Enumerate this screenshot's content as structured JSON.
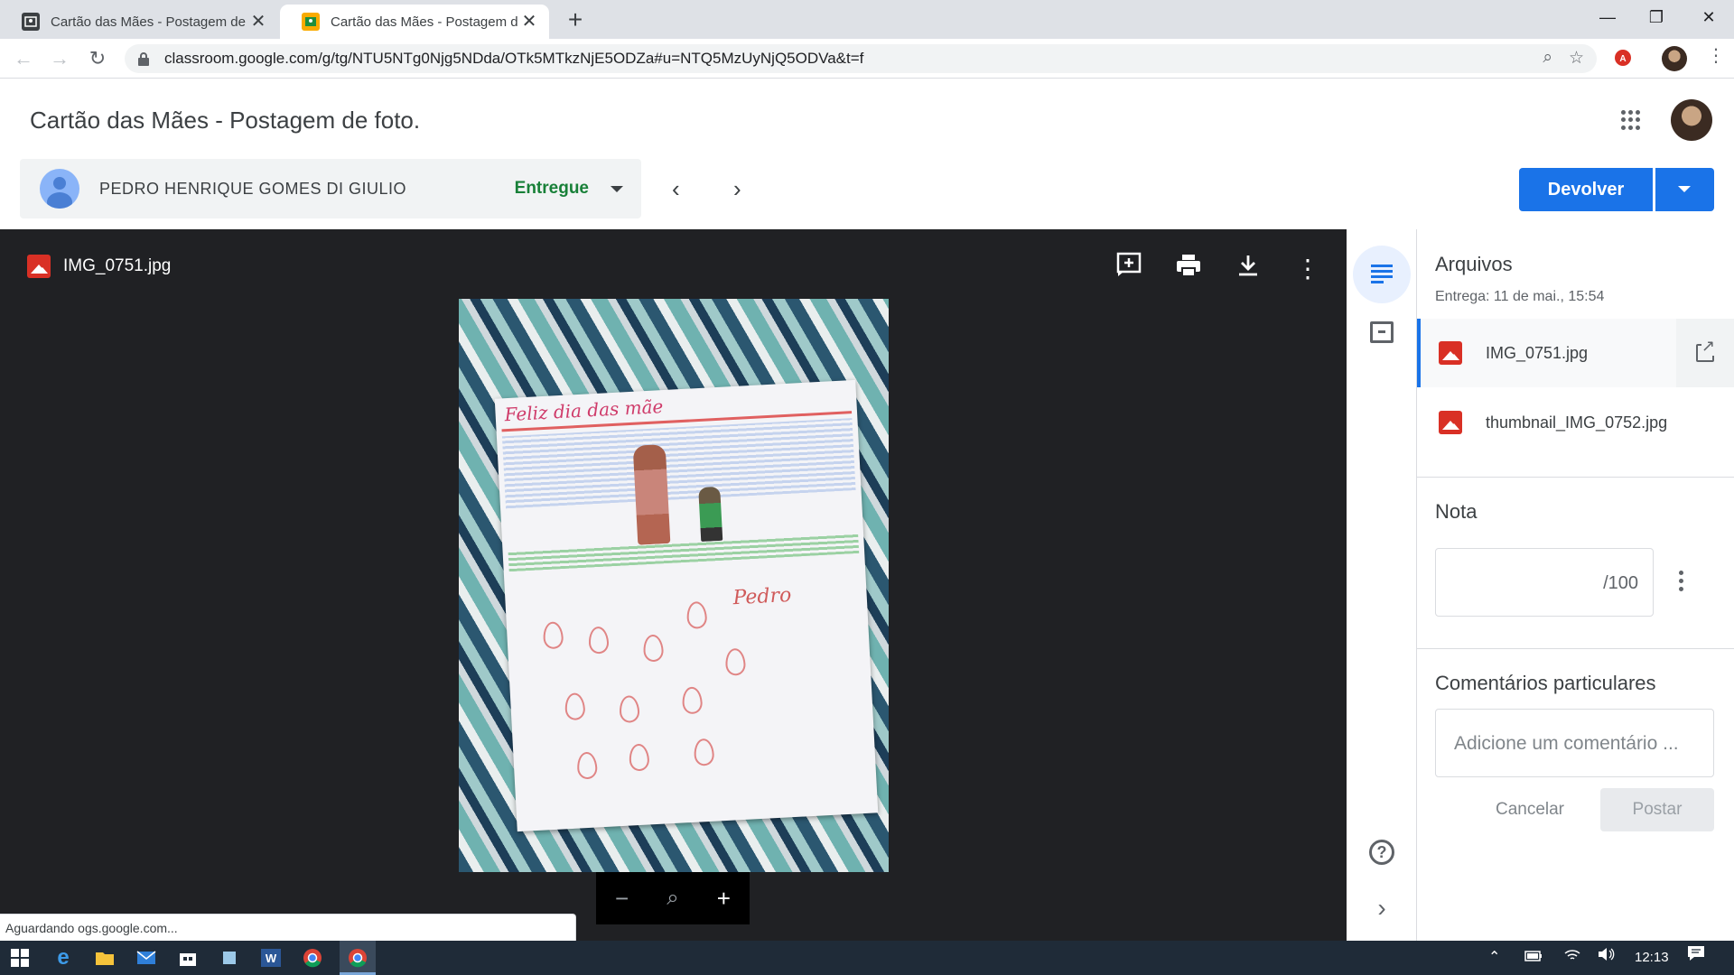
{
  "browser": {
    "tabs": [
      {
        "title": "Cartão das Mães - Postagem de f",
        "favicon": "classroom-icon",
        "active": false
      },
      {
        "title": "Cartão das Mães - Postagem de f",
        "favicon": "classroom-icon",
        "active": true
      }
    ],
    "url": "classroom.google.com/g/tg/NTU5NTg0Njg5NDda/OTk5MTkzNjE5ODZa#u=NTQ5MzUyNjQ5ODVa&t=f"
  },
  "header": {
    "title": "Cartão das Mães - Postagem de foto."
  },
  "student": {
    "name": "PEDRO HENRIQUE GOMES DI GIULIO",
    "status": "Entregue"
  },
  "actions": {
    "return_label": "Devolver"
  },
  "viewer": {
    "file_name": "IMG_0751.jpg",
    "drawing_header": "Feliz dia das mãe",
    "drawing_signature": "Pedro",
    "loading_status": "Aguardando ogs.google.com..."
  },
  "panel": {
    "files_heading": "Arquivos",
    "submitted": "Entrega: 11 de mai., 15:54",
    "files": [
      {
        "name": "IMG_0751.jpg"
      },
      {
        "name": "thumbnail_IMG_0752.jpg"
      }
    ],
    "grade_heading": "Nota",
    "grade_suffix": "/100",
    "comments_heading": "Comentários particulares",
    "comment_placeholder": "Adicione um comentário ...",
    "cancel_label": "Cancelar",
    "post_label": "Postar"
  },
  "taskbar": {
    "clock": "12:13"
  },
  "colors": {
    "primary": "#1a73e8",
    "status_green": "#188038",
    "viewer_bg": "#202124",
    "file_icon_red": "#d93025"
  }
}
